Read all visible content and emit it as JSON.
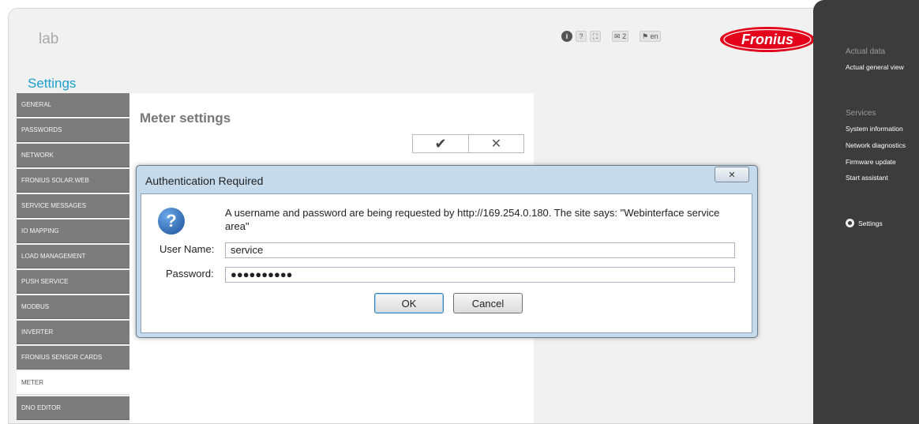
{
  "header": {
    "brand": "lab",
    "icons": [
      {
        "name": "info-icon",
        "glyph": "i"
      },
      {
        "name": "help-icon",
        "glyph": "?"
      },
      {
        "name": "fullscreen-icon",
        "glyph": "⛶"
      }
    ],
    "messages_count": "2",
    "language": "en",
    "logo_text": "Fronius",
    "logo_color": "#e2001a"
  },
  "page": {
    "title": "Settings",
    "accent": "#1a9fd0"
  },
  "sidebar": {
    "items": [
      {
        "label": "GENERAL",
        "active": false
      },
      {
        "label": "PASSWORDS",
        "active": false
      },
      {
        "label": "NETWORK",
        "active": false
      },
      {
        "label": "FRONIUS SOLAR.WEB",
        "active": false
      },
      {
        "label": "SERVICE MESSAGES",
        "active": false
      },
      {
        "label": "IO MAPPING",
        "active": false
      },
      {
        "label": "LOAD MANAGEMENT",
        "active": false
      },
      {
        "label": "PUSH SERVICE",
        "active": false
      },
      {
        "label": "MODBUS",
        "active": false
      },
      {
        "label": "INVERTER",
        "active": false
      },
      {
        "label": "FRONIUS SENSOR CARDS",
        "active": false
      },
      {
        "label": "METER",
        "active": true
      },
      {
        "label": "DNO EDITOR",
        "active": false
      }
    ]
  },
  "content": {
    "title": "Meter settings",
    "confirm_glyph": "✔",
    "cancel_glyph": "✕"
  },
  "right_panel": {
    "section_actual": "Actual data",
    "actual_general_view": "Actual general view",
    "section_services": "Services",
    "system_information": "System information",
    "network_diagnostics": "Network diagnostics",
    "firmware_update": "Firmware update",
    "start_assistant": "Start assistant",
    "settings": "Settings"
  },
  "dialog": {
    "title": "Authentication Required",
    "close_glyph": "✕",
    "message": "A username and password are being requested by http://169.254.0.180. The site says: \"Webinterface service area\"",
    "username_label": "User Name:",
    "username_value": "service",
    "password_label": "Password:",
    "password_value": "●●●●●●●●●●",
    "ok_label": "OK",
    "cancel_label": "Cancel"
  }
}
